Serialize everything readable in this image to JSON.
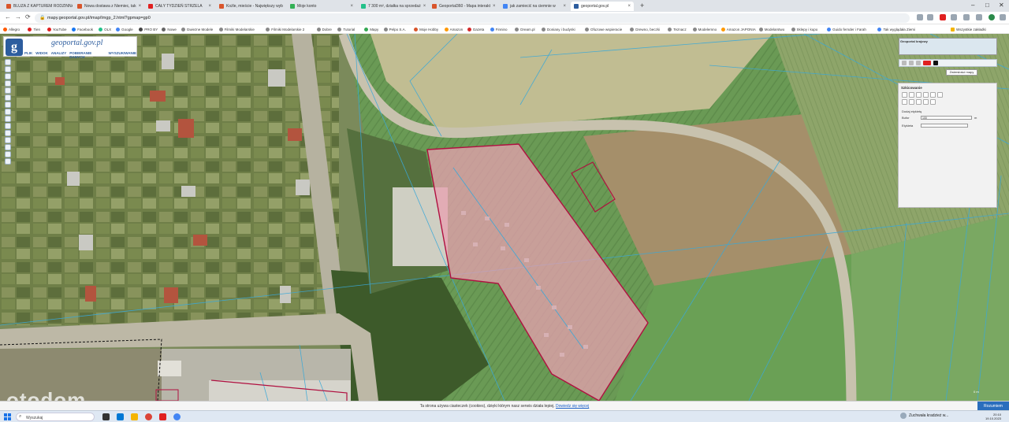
{
  "browser": {
    "tabs": [
      {
        "label": "BLUZA Z KAPTUREM RODZINNA",
        "color": "#d9552b"
      },
      {
        "label": "Nowa dostawa z Niemiec, tak",
        "color": "#d9552b"
      },
      {
        "label": "CAŁY TYDZIEŃ STRZELA",
        "color": "#e02020"
      },
      {
        "label": "Koźle, mieście - Największy wyb",
        "color": "#d9552b"
      },
      {
        "label": "Moje konto",
        "color": "#33b055"
      },
      {
        "label": "7 300 m², działka na sprzedaż",
        "color": "#23c18a"
      },
      {
        "label": "Geoportal360 - Mapa interakt",
        "color": "#d9552b"
      },
      {
        "label": "jak zamiecić na ciemnie w",
        "color": "#4285f4"
      },
      {
        "label": "geoportal.gov.pl",
        "color": "#2d5d9e"
      }
    ],
    "new_tab": "+",
    "window_controls": [
      "–",
      "□",
      "✕"
    ],
    "url": "mapy.geoportal.gov.pl/imap/Imgp_2.html?gpmap=gp0",
    "nav": {
      "back": "←",
      "forward": "→",
      "reload": "⟳"
    },
    "bookmarks": [
      {
        "label": "Allegro",
        "color": "#ff5a00"
      },
      {
        "label": "Tien",
        "color": "#e02020"
      },
      {
        "label": "YouTube",
        "color": "#e02020"
      },
      {
        "label": "Facebook",
        "color": "#1877f2"
      },
      {
        "label": "OLX",
        "color": "#23c18a"
      },
      {
        "label": "Google",
        "color": "#4285f4"
      },
      {
        "label": "PRO BY",
        "color": "#444444"
      },
      {
        "label": "Nowe",
        "color": "#666666"
      },
      {
        "label": "Gwiezne Modele",
        "color": "#888888"
      },
      {
        "label": "Filmiki Modelarskie",
        "color": "#888888"
      },
      {
        "label": "Filmiki Modelarskie 2",
        "color": "#888888"
      },
      {
        "label": "Dobre",
        "color": "#888888"
      },
      {
        "label": "Tutorial",
        "color": "#888888"
      },
      {
        "label": "Mapy",
        "color": "#34a853"
      },
      {
        "label": "Pelpo S.A.",
        "color": "#888888"
      },
      {
        "label": "Moje Hobby",
        "color": "#d9552b"
      },
      {
        "label": "Amazon",
        "color": "#ff9900"
      },
      {
        "label": "Gazeta",
        "color": "#d42a2a"
      },
      {
        "label": "Finnino",
        "color": "#4285f4"
      },
      {
        "label": "Dream.pl",
        "color": "#888888"
      },
      {
        "label": "Doniany i budynki",
        "color": "#888888"
      },
      {
        "label": "Ofuzowe wspieracie",
        "color": "#888888"
      },
      {
        "label": "Drewno, beczki",
        "color": "#888888"
      },
      {
        "label": "Teznacz",
        "color": "#888888"
      },
      {
        "label": "Modelemno",
        "color": "#888888"
      },
      {
        "label": "Amazon JAPONIA",
        "color": "#ff9900"
      },
      {
        "label": "Modelarstwo",
        "color": "#888888"
      },
      {
        "label": "Sklepy i kupo",
        "color": "#888888"
      },
      {
        "label": "Guido fernder i Farah",
        "color": "#4285f4"
      },
      {
        "label": "Tak wyglądała Ziemi",
        "color": "#4285f4"
      }
    ],
    "all_bookmarks": "Wszystkie zakładki"
  },
  "geoportal": {
    "title": "geoportal.gov.pl",
    "logo_letter": "g",
    "menu": [
      "PLIK",
      "WIDOK",
      "ANALIZY",
      "POBIERANIE DANYCH",
      "WYSZUKIWANIE"
    ],
    "overview_title": "Geoportal krajowy",
    "zoom_widget": "Zwiersłości mapy",
    "panel": {
      "title": "Szkicowanie",
      "label_section": "Dodaj etykietę",
      "buffer_label": "Bufor",
      "buffer_value": "100",
      "buffer_unit": "m",
      "label_label": "Etykieta",
      "label_value": ""
    },
    "scale_text": "0 m"
  },
  "map": {
    "parcel_fill": "#e8a0b0",
    "parcel_stroke": "#b01040",
    "boundary_color": "#3aa8d8"
  },
  "cookie_bar": {
    "text": "Ta strona używa ciasteczek (cookies), dzięki którym nasz serwis działa lepiej.",
    "link": "Dowiedz się więcej",
    "accept": "Rozumiem"
  },
  "watermark": "otodom",
  "taskbar": {
    "search": "Wyszukaj",
    "weather": "Zachmurzenie",
    "weather_sub": "Zuchwała kradzież w...",
    "time": "20:10",
    "date": "19.10.2023"
  }
}
